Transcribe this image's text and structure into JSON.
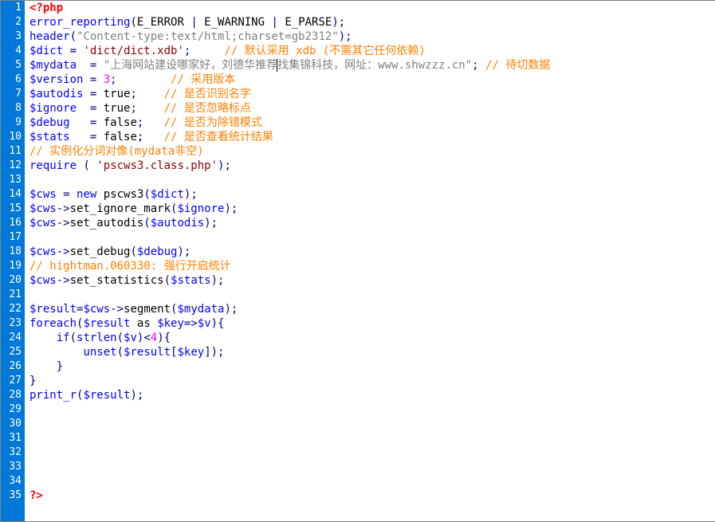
{
  "lines": [
    {
      "n": 1,
      "segs": [
        {
          "c": "t-red",
          "t": "<?php"
        }
      ]
    },
    {
      "n": 2,
      "segs": [
        {
          "c": "t-blue",
          "t": "error_reporting"
        },
        {
          "c": "t-navy",
          "t": "("
        },
        {
          "c": "t-black",
          "t": "E_ERROR "
        },
        {
          "c": "t-navy",
          "t": "|"
        },
        {
          "c": "t-black",
          "t": " E_WARNING "
        },
        {
          "c": "t-navy",
          "t": "|"
        },
        {
          "c": "t-black",
          "t": " E_PARSE"
        },
        {
          "c": "t-navy",
          "t": ");"
        }
      ]
    },
    {
      "n": 3,
      "segs": [
        {
          "c": "t-blue",
          "t": "header"
        },
        {
          "c": "t-navy",
          "t": "("
        },
        {
          "c": "t-gray",
          "t": "\"Content-type:text/html;charset=gb2312\""
        },
        {
          "c": "t-navy",
          "t": ");"
        }
      ]
    },
    {
      "n": 4,
      "segs": [
        {
          "c": "t-blue",
          "t": "$dict "
        },
        {
          "c": "t-navy",
          "t": "="
        },
        {
          "c": "t-darkred",
          "t": " 'dict/dict.xdb'"
        },
        {
          "c": "t-navy",
          "t": ";"
        },
        {
          "c": "t-black",
          "t": "     "
        },
        {
          "c": "t-orange",
          "t": "// 默认采用 xdb (不需其它任何依赖)"
        }
      ]
    },
    {
      "n": 5,
      "segs": [
        {
          "c": "t-blue",
          "t": "$mydata  "
        },
        {
          "c": "t-navy",
          "t": "="
        },
        {
          "c": "t-gray",
          "t": " \"上海网站建设哪家好，刘德华推荐"
        },
        {
          "c": "t-black cursor",
          "t": ""
        },
        {
          "c": "t-gray",
          "t": "找集锦科技，网址：www.shwzzz.cn\""
        },
        {
          "c": "t-navy",
          "t": ";"
        },
        {
          "c": "t-black",
          "t": " "
        },
        {
          "c": "t-orange",
          "t": "// 待切数据"
        }
      ]
    },
    {
      "n": 6,
      "segs": [
        {
          "c": "t-blue",
          "t": "$version "
        },
        {
          "c": "t-navy",
          "t": "="
        },
        {
          "c": "t-magenta",
          "t": " 3"
        },
        {
          "c": "t-navy",
          "t": ";"
        },
        {
          "c": "t-black",
          "t": "        "
        },
        {
          "c": "t-orange",
          "t": "// 采用版本"
        }
      ]
    },
    {
      "n": 7,
      "segs": [
        {
          "c": "t-blue",
          "t": "$autodis "
        },
        {
          "c": "t-navy",
          "t": "="
        },
        {
          "c": "t-black",
          "t": " true"
        },
        {
          "c": "t-navy",
          "t": ";"
        },
        {
          "c": "t-black",
          "t": "    "
        },
        {
          "c": "t-orange",
          "t": "// 是否识别名字"
        }
      ]
    },
    {
      "n": 8,
      "segs": [
        {
          "c": "t-blue",
          "t": "$ignore  "
        },
        {
          "c": "t-navy",
          "t": "="
        },
        {
          "c": "t-black",
          "t": " true"
        },
        {
          "c": "t-navy",
          "t": ";"
        },
        {
          "c": "t-black",
          "t": "    "
        },
        {
          "c": "t-orange",
          "t": "// 是否忽略标点"
        }
      ]
    },
    {
      "n": 9,
      "segs": [
        {
          "c": "t-blue",
          "t": "$debug   "
        },
        {
          "c": "t-navy",
          "t": "="
        },
        {
          "c": "t-black",
          "t": " false"
        },
        {
          "c": "t-navy",
          "t": ";"
        },
        {
          "c": "t-black",
          "t": "   "
        },
        {
          "c": "t-orange",
          "t": "// 是否为除错模式"
        }
      ]
    },
    {
      "n": 10,
      "segs": [
        {
          "c": "t-blue",
          "t": "$stats   "
        },
        {
          "c": "t-navy",
          "t": "="
        },
        {
          "c": "t-black",
          "t": " false"
        },
        {
          "c": "t-navy",
          "t": ";"
        },
        {
          "c": "t-black",
          "t": "   "
        },
        {
          "c": "t-orange",
          "t": "// 是否查看统计结果"
        }
      ]
    },
    {
      "n": 11,
      "segs": [
        {
          "c": "t-orange",
          "t": "// 实例化分词对像(mydata非空)"
        }
      ]
    },
    {
      "n": 12,
      "segs": [
        {
          "c": "t-blue",
          "t": "require "
        },
        {
          "c": "t-navy",
          "t": "("
        },
        {
          "c": "t-darkred",
          "t": " 'pscws3.class.php'"
        },
        {
          "c": "t-navy",
          "t": ");"
        }
      ]
    },
    {
      "n": 13,
      "segs": []
    },
    {
      "n": 14,
      "segs": [
        {
          "c": "t-blue",
          "t": "$cws "
        },
        {
          "c": "t-navy",
          "t": "="
        },
        {
          "c": "t-blue",
          "t": " new "
        },
        {
          "c": "t-black",
          "t": "pscws3"
        },
        {
          "c": "t-navy",
          "t": "("
        },
        {
          "c": "t-blue",
          "t": "$dict"
        },
        {
          "c": "t-navy",
          "t": ");"
        }
      ]
    },
    {
      "n": 15,
      "segs": [
        {
          "c": "t-blue",
          "t": "$cws"
        },
        {
          "c": "t-navy",
          "t": "->"
        },
        {
          "c": "t-black",
          "t": "set_ignore_mark"
        },
        {
          "c": "t-navy",
          "t": "("
        },
        {
          "c": "t-blue",
          "t": "$ignore"
        },
        {
          "c": "t-navy",
          "t": ");"
        }
      ]
    },
    {
      "n": 16,
      "segs": [
        {
          "c": "t-blue",
          "t": "$cws"
        },
        {
          "c": "t-navy",
          "t": "->"
        },
        {
          "c": "t-black",
          "t": "set_autodis"
        },
        {
          "c": "t-navy",
          "t": "("
        },
        {
          "c": "t-blue",
          "t": "$autodis"
        },
        {
          "c": "t-navy",
          "t": ");"
        }
      ]
    },
    {
      "n": 17,
      "segs": []
    },
    {
      "n": 18,
      "segs": [
        {
          "c": "t-blue",
          "t": "$cws"
        },
        {
          "c": "t-navy",
          "t": "->"
        },
        {
          "c": "t-black",
          "t": "set_debug"
        },
        {
          "c": "t-navy",
          "t": "("
        },
        {
          "c": "t-blue",
          "t": "$debug"
        },
        {
          "c": "t-navy",
          "t": ");"
        }
      ]
    },
    {
      "n": 19,
      "segs": [
        {
          "c": "t-orange",
          "t": "// hightman.060330: 强行开启统计"
        }
      ]
    },
    {
      "n": 20,
      "segs": [
        {
          "c": "t-blue",
          "t": "$cws"
        },
        {
          "c": "t-navy",
          "t": "->"
        },
        {
          "c": "t-black",
          "t": "set_statistics"
        },
        {
          "c": "t-navy",
          "t": "("
        },
        {
          "c": "t-blue",
          "t": "$stats"
        },
        {
          "c": "t-navy",
          "t": ");"
        }
      ]
    },
    {
      "n": 21,
      "segs": []
    },
    {
      "n": 22,
      "segs": [
        {
          "c": "t-blue",
          "t": "$result"
        },
        {
          "c": "t-navy",
          "t": "="
        },
        {
          "c": "t-blue",
          "t": "$cws"
        },
        {
          "c": "t-navy",
          "t": "->"
        },
        {
          "c": "t-black",
          "t": "segment"
        },
        {
          "c": "t-navy",
          "t": "("
        },
        {
          "c": "t-blue",
          "t": "$mydata"
        },
        {
          "c": "t-navy",
          "t": ");"
        }
      ]
    },
    {
      "n": 23,
      "segs": [
        {
          "c": "t-blue",
          "t": "foreach"
        },
        {
          "c": "t-navy",
          "t": "("
        },
        {
          "c": "t-blue",
          "t": "$result"
        },
        {
          "c": "t-black",
          "t": " as "
        },
        {
          "c": "t-blue",
          "t": "$key"
        },
        {
          "c": "t-navy",
          "t": "=>"
        },
        {
          "c": "t-blue",
          "t": "$v"
        },
        {
          "c": "t-navy",
          "t": "){"
        }
      ]
    },
    {
      "n": 24,
      "segs": [
        {
          "c": "t-black",
          "t": "    "
        },
        {
          "c": "t-blue",
          "t": "if"
        },
        {
          "c": "t-navy",
          "t": "("
        },
        {
          "c": "t-blue",
          "t": "strlen"
        },
        {
          "c": "t-navy",
          "t": "("
        },
        {
          "c": "t-blue",
          "t": "$v"
        },
        {
          "c": "t-navy",
          "t": ")<"
        },
        {
          "c": "t-magenta",
          "t": "4"
        },
        {
          "c": "t-navy",
          "t": "){"
        }
      ]
    },
    {
      "n": 25,
      "segs": [
        {
          "c": "t-black",
          "t": "        "
        },
        {
          "c": "t-blue",
          "t": "unset"
        },
        {
          "c": "t-navy",
          "t": "("
        },
        {
          "c": "t-blue",
          "t": "$result"
        },
        {
          "c": "t-navy",
          "t": "["
        },
        {
          "c": "t-blue",
          "t": "$key"
        },
        {
          "c": "t-navy",
          "t": "]);"
        }
      ]
    },
    {
      "n": 26,
      "segs": [
        {
          "c": "t-black",
          "t": "    "
        },
        {
          "c": "t-navy",
          "t": "}"
        }
      ]
    },
    {
      "n": 27,
      "segs": [
        {
          "c": "t-navy",
          "t": "}"
        }
      ]
    },
    {
      "n": 28,
      "segs": [
        {
          "c": "t-blue",
          "t": "print_r"
        },
        {
          "c": "t-navy",
          "t": "("
        },
        {
          "c": "t-blue",
          "t": "$result"
        },
        {
          "c": "t-navy",
          "t": ");"
        }
      ]
    },
    {
      "n": 29,
      "segs": []
    },
    {
      "n": 30,
      "segs": []
    },
    {
      "n": 31,
      "segs": []
    },
    {
      "n": 32,
      "segs": []
    },
    {
      "n": 33,
      "segs": []
    },
    {
      "n": 34,
      "segs": []
    },
    {
      "n": 35,
      "segs": [
        {
          "c": "t-red",
          "t": "?>"
        }
      ]
    }
  ]
}
